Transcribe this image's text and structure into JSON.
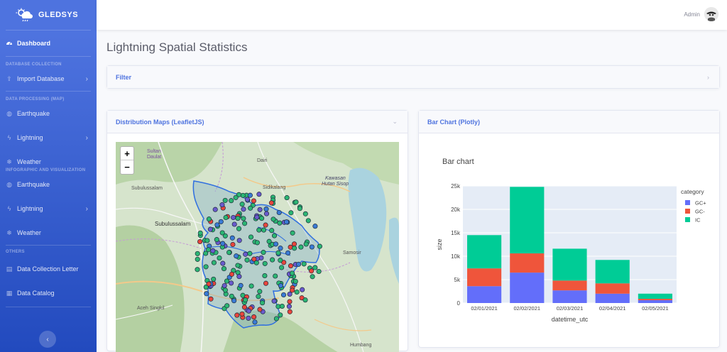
{
  "app": {
    "name": "GLEDSYS"
  },
  "sidebar": {
    "dashboard": "Dashboard",
    "section_db": "DATABASE COLLECTION",
    "import_db": "Import Database",
    "section_proc": "DATA PROCESSING (MAP)",
    "proc_earthquake": "Earthquake",
    "proc_lightning": "Lightning",
    "proc_weather": "Weather",
    "section_info": "INFOGRAPHIC AND VISUALIZATION",
    "info_earthquake": "Earthquake",
    "info_lightning": "Lightning",
    "info_weather": "Weather",
    "section_others": "OTHERS",
    "letter": "Data Collection Letter",
    "catalog": "Data Catalog"
  },
  "topbar": {
    "user": "Admin"
  },
  "page": {
    "title": "Lightning Spatial Statistics"
  },
  "filter": {
    "title": "Filter"
  },
  "map_card": {
    "title": "Distribution Maps (LeafletJS)",
    "labels": {
      "sultan": "Sultan",
      "daulat": "Daulat",
      "dairi": "Dairi",
      "sidikalang": "Sidikalang",
      "kawasan": "Kawasan",
      "hutan": "Hutan Sisop",
      "subulussalam_top": "Subulussalam",
      "subulussalam": "Subulussalam",
      "samosir": "Samosir",
      "aceh_singkil": "Aceh Singkil",
      "humbang": "Humbang"
    },
    "zoom_in": "+",
    "zoom_out": "−"
  },
  "chart_card": {
    "title": "Bar Chart (Plotly)"
  },
  "chart_data": {
    "type": "bar",
    "title": "Bar chart",
    "xlabel": "datetime_utc",
    "ylabel": "size",
    "categories": [
      "02/01/2021",
      "02/02/2021",
      "02/03/2021",
      "02/04/2021",
      "02/05/2021"
    ],
    "series": [
      {
        "name": "GC+",
        "color": "#636efa",
        "values": [
          3600,
          6500,
          2700,
          2000,
          600
        ]
      },
      {
        "name": "GC-",
        "color": "#ef553b",
        "values": [
          3800,
          4100,
          2100,
          2200,
          300
        ]
      },
      {
        "name": "IC",
        "color": "#00cc96",
        "values": [
          7100,
          14200,
          6800,
          5000,
          1100
        ]
      }
    ],
    "ylim": [
      0,
      25000
    ],
    "yticks": [
      "0",
      "5k",
      "10k",
      "15k",
      "20k",
      "25k"
    ],
    "legend_title": "category",
    "legend": "right",
    "grid": true
  }
}
